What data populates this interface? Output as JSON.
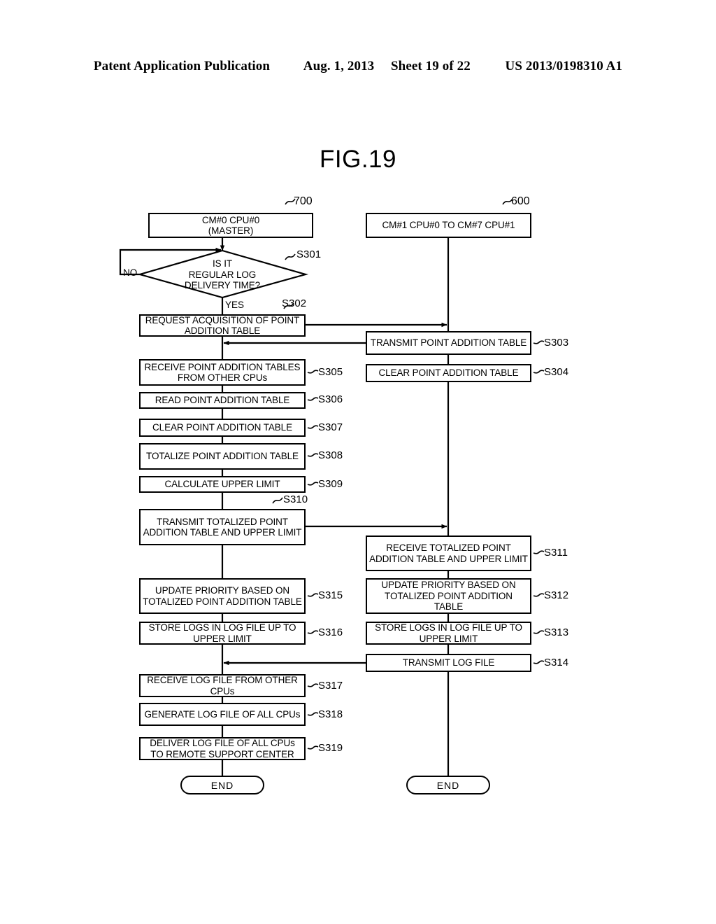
{
  "header": {
    "publication": "Patent Application Publication",
    "date": "Aug. 1, 2013",
    "sheet": "Sheet 19 of 22",
    "number": "US 2013/0198310 A1"
  },
  "figure": {
    "title": "FIG.19"
  },
  "lanes": [
    {
      "id": "master",
      "ref_numeral": "700",
      "header_label": "CM#0 CPU#0\n(MASTER)",
      "header_line1": "CM#0 CPU#0",
      "header_line2": "(MASTER)"
    },
    {
      "id": "slaves",
      "ref_numeral": "600",
      "header_label": "CM#1 CPU#0 TO CM#7 CPU#1"
    }
  ],
  "decision": {
    "step": "S301",
    "line1": "IS IT",
    "line2": "REGULAR LOG",
    "line3": "DELIVERY TIME?",
    "yes_label": "YES",
    "no_label": "NO"
  },
  "left_steps": [
    {
      "step": "S302",
      "label": "REQUEST ACQUISITION OF POINT ADDITION TABLE"
    },
    {
      "step": "S305",
      "label": "RECEIVE POINT ADDITION TABLES FROM OTHER CPUs"
    },
    {
      "step": "S306",
      "label": "READ POINT ADDITION TABLE"
    },
    {
      "step": "S307",
      "label": "CLEAR POINT ADDITION TABLE"
    },
    {
      "step": "S308",
      "label": "TOTALIZE POINT ADDITION TABLE"
    },
    {
      "step": "S309",
      "label": "CALCULATE UPPER LIMIT"
    },
    {
      "step": "S310",
      "label": "TRANSMIT TOTALIZED POINT ADDITION TABLE AND UPPER LIMIT"
    },
    {
      "step": "S315",
      "label": "UPDATE PRIORITY BASED ON TOTALIZED POINT ADDITION TABLE"
    },
    {
      "step": "S316",
      "label": "STORE LOGS IN LOG FILE UP TO UPPER LIMIT"
    },
    {
      "step": "S317",
      "label": "RECEIVE LOG FILE FROM OTHER CPUs"
    },
    {
      "step": "S318",
      "label": "GENERATE LOG FILE OF ALL CPUs"
    },
    {
      "step": "S319",
      "label": "DELIVER LOG FILE OF ALL CPUs TO REMOTE SUPPORT CENTER"
    }
  ],
  "right_steps": [
    {
      "step": "S303",
      "label": "TRANSMIT POINT ADDITION TABLE"
    },
    {
      "step": "S304",
      "label": "CLEAR POINT ADDITION TABLE"
    },
    {
      "step": "S311",
      "label": "RECEIVE TOTALIZED POINT ADDITION TABLE AND UPPER LIMIT"
    },
    {
      "step": "S312",
      "label": "UPDATE PRIORITY BASED ON TOTALIZED POINT ADDITION TABLE"
    },
    {
      "step": "S313",
      "label": "STORE LOGS IN LOG FILE UP TO UPPER LIMIT"
    },
    {
      "step": "S314",
      "label": "TRANSMIT LOG FILE"
    }
  ],
  "terminators": {
    "left_end": "END",
    "right_end": "END"
  },
  "colors": {
    "line": "#000000",
    "background": "#ffffff"
  }
}
